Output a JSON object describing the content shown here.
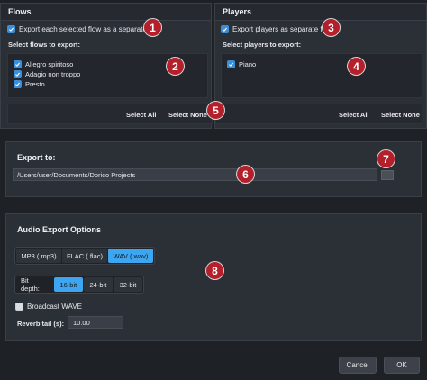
{
  "flows": {
    "title": "Flows",
    "export_separate_label": "Export each selected flow as a separate file",
    "select_label": "Select flows to export:",
    "items": [
      {
        "label": "Allegro spiritoso"
      },
      {
        "label": "Adagio non troppo"
      },
      {
        "label": "Presto"
      }
    ],
    "select_all": "Select All",
    "select_none": "Select None"
  },
  "players": {
    "title": "Players",
    "export_separate_label": "Export players as separate files",
    "select_label": "Select players to export:",
    "items": [
      {
        "label": "Piano"
      }
    ],
    "select_all": "Select All",
    "select_none": "Select None"
  },
  "export": {
    "title": "Export to:",
    "path": "/Users/user/Documents/Dorico Projects",
    "browse": "..."
  },
  "audio": {
    "title": "Audio Export Options",
    "formats": [
      "MP3 (.mp3)",
      "FLAC (.flac)",
      "WAV (.wav)"
    ],
    "selected_format": "WAV (.wav)",
    "bit_depth_label": "Bit depth:",
    "bit_depths": [
      "16-bit",
      "24-bit",
      "32-bit"
    ],
    "selected_bit_depth": "16-bit",
    "broadcast_wave_label": "Broadcast WAVE",
    "reverb_label": "Reverb tail (s):",
    "reverb_value": "10.00"
  },
  "footer": {
    "cancel": "Cancel",
    "ok": "OK"
  },
  "callouts": [
    "1",
    "2",
    "3",
    "4",
    "5",
    "6",
    "7",
    "8"
  ],
  "colors": {
    "accent": "#3ea6f0",
    "callout": "#b3202b",
    "background": "#1e2126",
    "panel": "#2b2f36"
  }
}
